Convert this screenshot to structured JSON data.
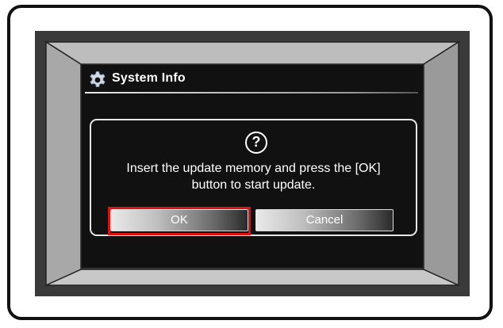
{
  "screen": {
    "title": "System Info",
    "title_icon": "gear-icon",
    "dialog": {
      "icon": "question-icon",
      "icon_glyph": "?",
      "message_line1": "Insert the update memory and press the [OK]",
      "message_line2": "button to start update.",
      "ok_label": "OK",
      "cancel_label": "Cancel"
    }
  },
  "colors": {
    "screen_bg": "#111111",
    "bezel": "#3a3a3a",
    "highlight": "#e01010"
  }
}
